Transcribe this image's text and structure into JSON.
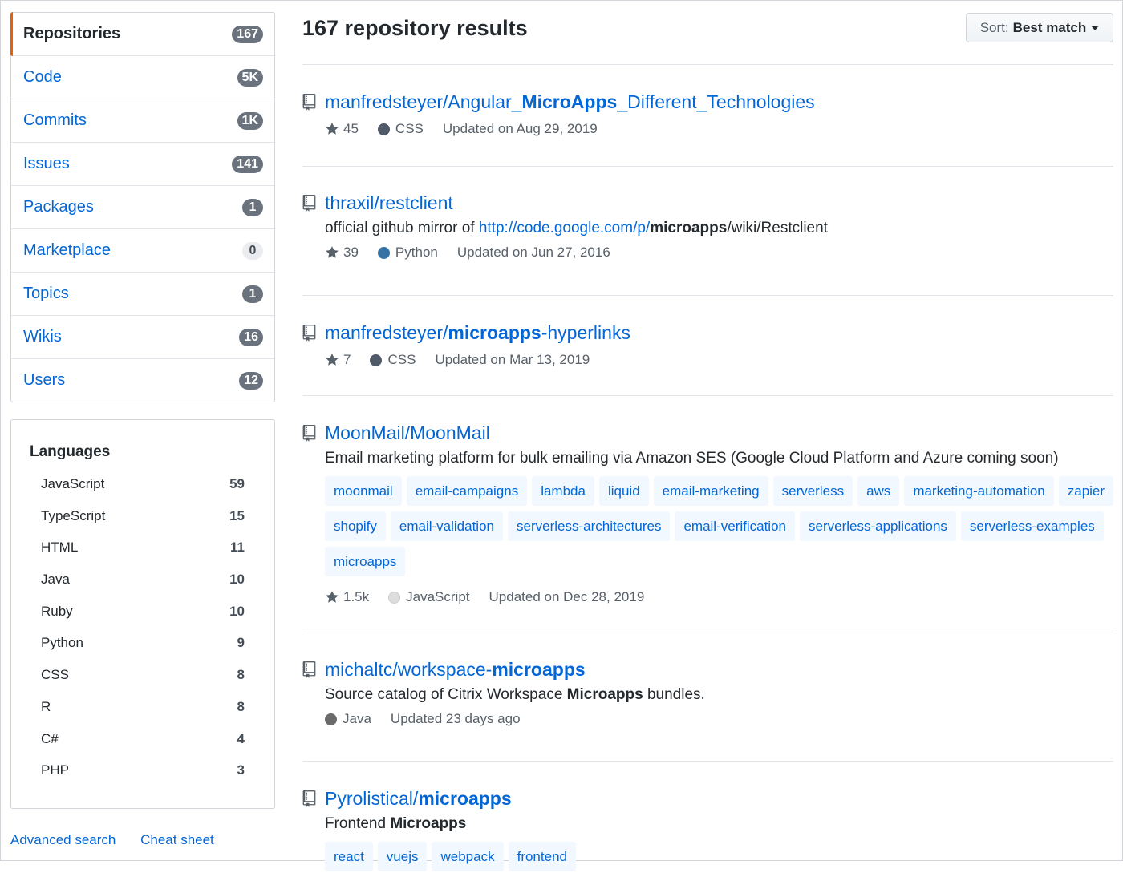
{
  "sidebar": {
    "menu": [
      {
        "label": "Repositories",
        "count": "167",
        "selected": true
      },
      {
        "label": "Code",
        "count": "5K"
      },
      {
        "label": "Commits",
        "count": "1K"
      },
      {
        "label": "Issues",
        "count": "141"
      },
      {
        "label": "Packages",
        "count": "1"
      },
      {
        "label": "Marketplace",
        "count": "0"
      },
      {
        "label": "Topics",
        "count": "1"
      },
      {
        "label": "Wikis",
        "count": "16"
      },
      {
        "label": "Users",
        "count": "12"
      }
    ],
    "languages_title": "Languages",
    "languages": [
      {
        "name": "JavaScript",
        "count": "59"
      },
      {
        "name": "TypeScript",
        "count": "15"
      },
      {
        "name": "HTML",
        "count": "11"
      },
      {
        "name": "Java",
        "count": "10"
      },
      {
        "name": "Ruby",
        "count": "10"
      },
      {
        "name": "Python",
        "count": "9"
      },
      {
        "name": "CSS",
        "count": "8"
      },
      {
        "name": "R",
        "count": "8"
      },
      {
        "name": "C#",
        "count": "4"
      },
      {
        "name": "PHP",
        "count": "3"
      }
    ],
    "advanced_search": "Advanced search",
    "cheat_sheet": "Cheat sheet"
  },
  "header": {
    "title": "167 repository results",
    "sort_key": "Sort:",
    "sort_value": "Best match"
  },
  "results": [
    {
      "repo": [
        {
          "t": "manfredsteyer/Angular_"
        },
        {
          "t": "MicroApps",
          "b": true
        },
        {
          "t": "_Different_Technologies"
        }
      ],
      "stars": "45",
      "language": "CSS",
      "language_color": "#563d7c",
      "updated": "Updated on Aug 29, 2019"
    },
    {
      "repo": [
        {
          "t": "thraxil/restclient"
        }
      ],
      "description": [
        {
          "t": "official github mirror of "
        },
        {
          "t": "http://code.google.com/p/",
          "link": true
        },
        {
          "t": "microapps",
          "b": true
        },
        {
          "t": "/wiki/Restclient"
        }
      ],
      "stars": "39",
      "language": "Python",
      "language_color": "#3572A5",
      "updated": "Updated on Jun 27, 2016"
    },
    {
      "repo": [
        {
          "t": "manfredsteyer/"
        },
        {
          "t": "microapps",
          "b": true
        },
        {
          "t": "-hyperlinks"
        }
      ],
      "stars": "7",
      "language": "CSS",
      "language_color": "#563d7c",
      "updated": "Updated on Mar 13, 2019"
    },
    {
      "repo": [
        {
          "t": "MoonMail/MoonMail"
        }
      ],
      "description": [
        {
          "t": "Email marketing platform for bulk emailing via Amazon SES (Google Cloud Platform and Azure coming soon)"
        }
      ],
      "topics": [
        "moonmail",
        "email-campaigns",
        "lambda",
        "liquid",
        "email-marketing",
        "serverless",
        "aws",
        "marketing-automation",
        "zapier",
        "shopify",
        "email-validation",
        "serverless-architectures",
        "email-verification",
        "serverless-applications",
        "serverless-examples",
        "microapps"
      ],
      "stars": "1.5k",
      "language": "JavaScript",
      "language_color": "#f1e05a",
      "updated": "Updated on Dec 28, 2019"
    },
    {
      "repo": [
        {
          "t": "michaltc/workspace-"
        },
        {
          "t": "microapps",
          "b": true
        }
      ],
      "description": [
        {
          "t": "Source catalog of Citrix Workspace "
        },
        {
          "t": "Microapps",
          "b": true
        },
        {
          "t": " bundles."
        }
      ],
      "language": "Java",
      "language_color": "#b07219",
      "updated": "Updated 23 days ago"
    },
    {
      "repo": [
        {
          "t": "Pyrolistical/"
        },
        {
          "t": "microapps",
          "b": true
        }
      ],
      "description": [
        {
          "t": "Frontend "
        },
        {
          "t": "Microapps",
          "b": true
        }
      ],
      "topics": [
        "react",
        "vuejs",
        "webpack",
        "frontend"
      ]
    }
  ]
}
